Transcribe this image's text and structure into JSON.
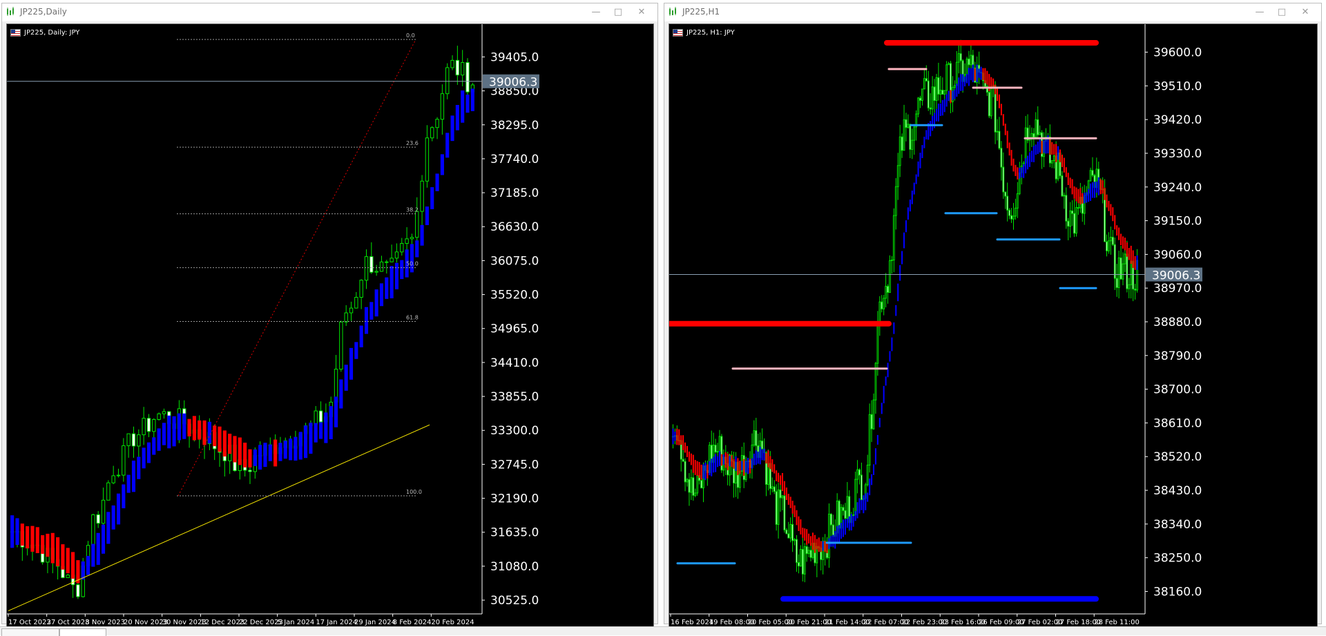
{
  "colors": {
    "bg": "#000000",
    "bull": "#00e600",
    "bear": "#ffffff",
    "tstrUp": "#0000ff",
    "tstrDn": "#ff0000",
    "ma": "#f0e000",
    "fib": "#9a9a9a",
    "pink": "#ffb6c1",
    "cyan": "#1e9bff",
    "priceLabelBg": "#5d7184"
  },
  "left_window": {
    "title": "JP225,Daily",
    "symbol_label": "JP225, Daily:  JPY",
    "current_price": "39006.3",
    "price_ticks": [
      "39405.0",
      "38850.0",
      "38295.0",
      "37740.0",
      "37185.0",
      "36630.0",
      "36075.0",
      "35520.0",
      "34965.0",
      "34410.0",
      "33855.0",
      "33300.0",
      "32745.0",
      "32190.0",
      "31635.0",
      "31080.0",
      "30525.0"
    ],
    "date_ticks": [
      "17 Oct 2023",
      "27 Oct 2023",
      "8 Nov 2023",
      "20 Nov 2023",
      "30 Nov 2023",
      "12 Dec 2023",
      "22 Dec 2023",
      "5 Jan 2024",
      "17 Jan 2024",
      "29 Jan 2024",
      "8 Feb 2024",
      "20 Feb 2024"
    ],
    "fib_levels": [
      "0.0",
      "23.6",
      "38.2",
      "50.0",
      "61.8",
      "100.0"
    ]
  },
  "right_window": {
    "title": "JP225,H1",
    "symbol_label": "JP225, H1:  JPY",
    "current_price": "39006.3",
    "price_ticks": [
      "39600.0",
      "39510.0",
      "39420.0",
      "39330.0",
      "39240.0",
      "39150.0",
      "39060.0",
      "38970.0",
      "38880.0",
      "38790.0",
      "38700.0",
      "38610.0",
      "38520.0",
      "38430.0",
      "38340.0",
      "38250.0",
      "38160.0"
    ],
    "date_ticks": [
      "16 Feb 2024",
      "19 Feb 08:00",
      "20 Feb 05:00",
      "20 Feb 21:00",
      "21 Feb 14:00",
      "22 Feb 07:00",
      "22 Feb 23:00",
      "23 Feb 16:00",
      "26 Feb 09:00",
      "27 Feb 02:00",
      "27 Feb 18:00",
      "28 Feb 11:00"
    ]
  },
  "chart_data": [
    {
      "type": "candlestick",
      "title": "JP225, Daily:  JPY",
      "ylim": [
        30300,
        39850
      ],
      "y_ticks": [
        39405,
        38850,
        38295,
        37740,
        37185,
        36630,
        36075,
        35520,
        34965,
        34410,
        33855,
        33300,
        32745,
        32190,
        31635,
        31080,
        30525
      ],
      "x": [
        "17 Oct 2023",
        "27 Oct 2023",
        "8 Nov 2023",
        "20 Nov 2023",
        "30 Nov 2023",
        "12 Dec 2023",
        "22 Dec 2023",
        "5 Jan 2024",
        "17 Jan 2024",
        "29 Jan 2024",
        "8 Feb 2024",
        "20 Feb 2024"
      ],
      "anchor_closes": [
        31650,
        31450,
        31150,
        30700,
        31900,
        32750,
        33250,
        33550,
        33450,
        33250,
        33000,
        32650,
        32950,
        33150,
        33300,
        33550,
        35250,
        36050,
        35900,
        36350,
        38300,
        39250,
        39006.3
      ],
      "fib_levels": [
        {
          "label": "0.0",
          "value": 39690
        },
        {
          "label": "23.6",
          "value": 37930
        },
        {
          "label": "38.2",
          "value": 36840
        },
        {
          "label": "50.0",
          "value": 35960
        },
        {
          "label": "61.8",
          "value": 35080
        },
        {
          "label": "100.0",
          "value": 32230
        }
      ],
      "moving_average": {
        "start": 30350,
        "end": 33390
      },
      "current_price": 39006.3
    },
    {
      "type": "candlestick",
      "title": "JP225, H1:  JPY",
      "ylim": [
        38100,
        39660
      ],
      "y_ticks": [
        39600,
        39510,
        39420,
        39330,
        39240,
        39150,
        39060,
        38970,
        38880,
        38790,
        38700,
        38610,
        38520,
        38430,
        38340,
        38250,
        38160
      ],
      "x": [
        "16 Feb 2024",
        "19 Feb 08:00",
        "20 Feb 05:00",
        "20 Feb 21:00",
        "21 Feb 14:00",
        "22 Feb 07:00",
        "22 Feb 23:00",
        "23 Feb 16:00",
        "26 Feb 09:00",
        "27 Feb 02:00",
        "27 Feb 18:00",
        "28 Feb 11:00"
      ],
      "anchor_closes": [
        38620,
        38420,
        38540,
        38480,
        38570,
        38380,
        38240,
        38290,
        38360,
        38460,
        38970,
        39380,
        39480,
        39520,
        39560,
        39480,
        39190,
        39420,
        39310,
        39150,
        39250,
        39020,
        39006.3
      ],
      "support_resistance": [
        {
          "value": 39625,
          "color": "red"
        },
        {
          "value": 38875,
          "color": "red"
        },
        {
          "value": 38140,
          "color": "blue"
        },
        {
          "value": 39555,
          "color": "pink"
        },
        {
          "value": 39505,
          "color": "pink"
        },
        {
          "value": 39370,
          "color": "pink"
        },
        {
          "value": 38755,
          "color": "pink"
        },
        {
          "value": 39405,
          "color": "cyan"
        },
        {
          "value": 39170,
          "color": "cyan"
        },
        {
          "value": 39100,
          "color": "cyan"
        },
        {
          "value": 38970,
          "color": "cyan"
        },
        {
          "value": 38235,
          "color": "cyan"
        },
        {
          "value": 38290,
          "color": "cyan"
        }
      ],
      "current_price": 39006.3
    }
  ]
}
